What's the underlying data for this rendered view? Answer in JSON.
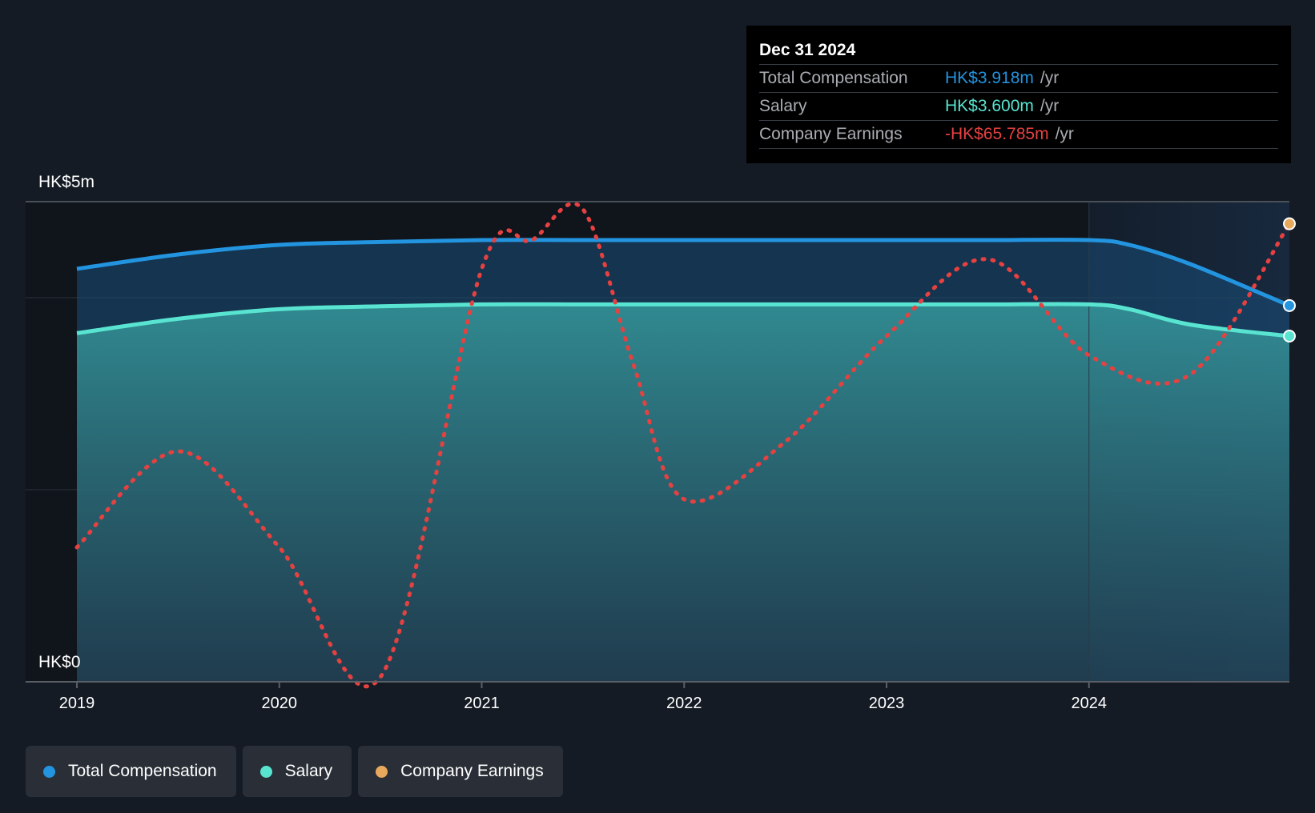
{
  "tooltip": {
    "date": "Dec 31 2024",
    "rows": [
      {
        "label": "Total Compensation",
        "value": "HK$3.918m",
        "unit": "/yr",
        "color": "#2394df"
      },
      {
        "label": "Salary",
        "value": "HK$3.600m",
        "unit": "/yr",
        "color": "#58e4d0"
      },
      {
        "label": "Company Earnings",
        "value": "-HK$65.785m",
        "unit": "/yr",
        "color": "#e64141"
      }
    ]
  },
  "legend": [
    {
      "label": "Total Compensation",
      "color": "#2394df"
    },
    {
      "label": "Salary",
      "color": "#58e4d0"
    },
    {
      "label": "Company Earnings",
      "color": "#e8a95c"
    }
  ],
  "chart_data": {
    "type": "area",
    "y_axis_labels": {
      "top": "HK$5m",
      "bottom": "HK$0"
    },
    "ylim": [
      0,
      5
    ],
    "xlim": [
      2019.0,
      2024.99
    ],
    "x_ticks": [
      2019,
      2020,
      2021,
      2022,
      2023,
      2024
    ],
    "x_tick_labels": [
      "2019",
      "2020",
      "2021",
      "2022",
      "2023",
      "2024"
    ],
    "highlight_start": 2024.0,
    "colors": {
      "total": "#2394df",
      "salary": "#58e4d0",
      "earnings": "#e64141",
      "earnings_marker": "#e8a95c"
    },
    "series": [
      {
        "name": "Total Compensation",
        "x": [
          2019.0,
          2019.5,
          2020.0,
          2020.5,
          2021.0,
          2021.5,
          2022.0,
          2022.5,
          2023.0,
          2023.5,
          2024.0,
          2024.2,
          2024.5,
          2024.99
        ],
        "values": [
          4.3,
          4.45,
          4.55,
          4.58,
          4.6,
          4.6,
          4.6,
          4.6,
          4.6,
          4.6,
          4.6,
          4.55,
          4.35,
          3.918
        ]
      },
      {
        "name": "Salary",
        "x": [
          2019.0,
          2019.5,
          2020.0,
          2020.5,
          2021.0,
          2021.5,
          2022.0,
          2022.5,
          2023.0,
          2023.5,
          2024.0,
          2024.2,
          2024.5,
          2024.99
        ],
        "values": [
          3.63,
          3.78,
          3.88,
          3.91,
          3.93,
          3.93,
          3.93,
          3.93,
          3.93,
          3.93,
          3.93,
          3.88,
          3.72,
          3.6
        ]
      },
      {
        "name": "Company Earnings",
        "x": [
          2019.0,
          2019.5,
          2020.0,
          2020.5,
          2021.0,
          2021.25,
          2021.5,
          2021.75,
          2022.0,
          2022.5,
          2023.0,
          2023.5,
          2024.0,
          2024.5,
          2024.99
        ],
        "values": [
          1.4,
          2.4,
          1.4,
          0.05,
          4.3,
          4.6,
          4.92,
          3.3,
          1.9,
          2.5,
          3.6,
          4.4,
          3.4,
          3.2,
          4.77
        ]
      }
    ]
  }
}
